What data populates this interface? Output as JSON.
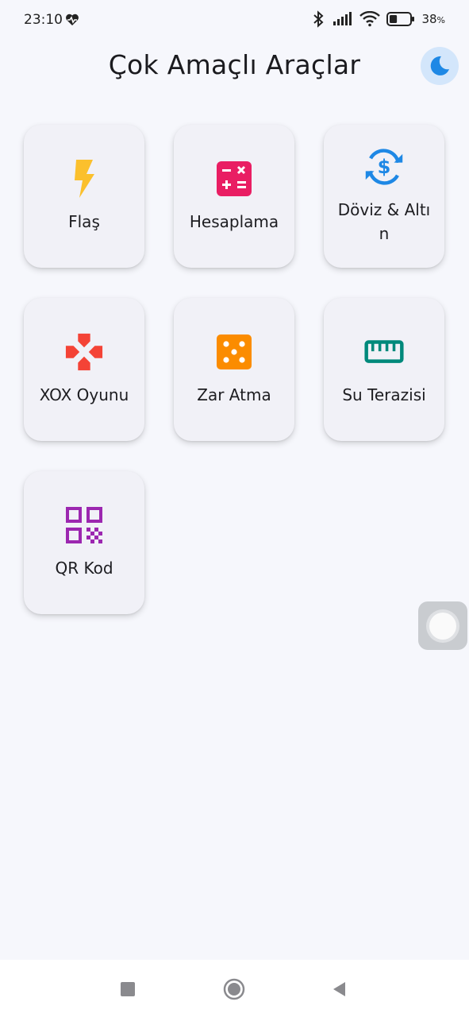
{
  "status_bar": {
    "time": "23:10",
    "battery_text": "38",
    "battery_percent_sign": "%",
    "battery_level": 0.38,
    "icons": [
      "heart-rate-icon",
      "bluetooth-icon",
      "signal-icon",
      "wifi-icon",
      "battery-icon"
    ]
  },
  "header": {
    "title": "Çok Amaçlı Araçlar",
    "theme_toggle_icon": "moon-icon",
    "theme_toggle_color": "#1e88e5"
  },
  "tools": [
    {
      "label": "Flaş",
      "icon": "flash-icon",
      "color": "#fbc02d"
    },
    {
      "label": "Hesaplama",
      "icon": "calculator-icon",
      "color": "#e91e63"
    },
    {
      "label": "Döviz & Altın",
      "icon": "currency-exchange-icon",
      "color": "#1e88e5"
    },
    {
      "label": "XOX Oyunu",
      "icon": "gamepad-icon",
      "color": "#f44336"
    },
    {
      "label": "Zar Atma",
      "icon": "dice-icon",
      "color": "#fb8c00"
    },
    {
      "label": "Su Terazisi",
      "icon": "ruler-icon",
      "color": "#00897b"
    },
    {
      "label": "QR Kod",
      "icon": "qr-code-icon",
      "color": "#9c27b0"
    }
  ],
  "nav_bar": {
    "icons": [
      "recent-apps-icon",
      "home-icon",
      "back-icon"
    ]
  }
}
